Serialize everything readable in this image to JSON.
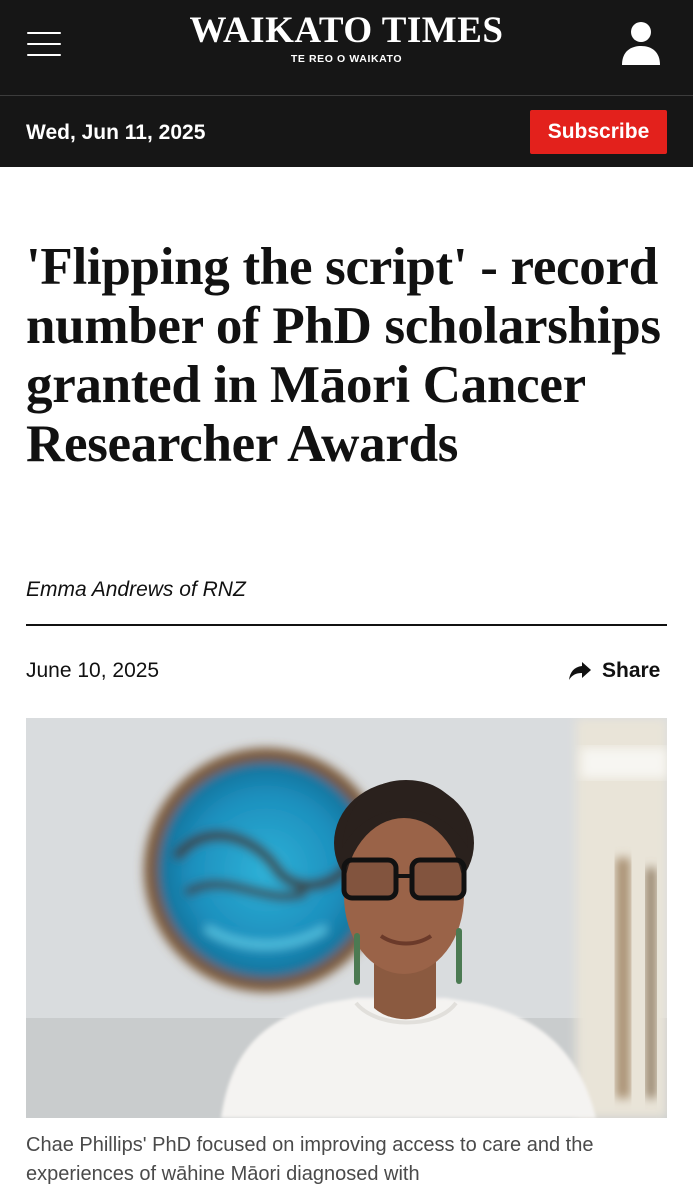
{
  "masthead": {
    "title": "WAIKATO TIMES",
    "subtitle": "TE REO O WAIKATO"
  },
  "icons": {
    "menu": "hamburger-menu-icon",
    "account": "user-account-icon",
    "share": "share-arrow-icon"
  },
  "datebar": {
    "date": "Wed, Jun 11, 2025",
    "subscribe_label": "Subscribe"
  },
  "article": {
    "headline": "'Flipping the script' - record number of PhD scholarships granted in Māori Cancer Researcher Awards",
    "byline": "Emma Andrews of RNZ",
    "published": "June 10, 2025",
    "share_label": "Share",
    "caption": "Chae Phillips' PhD focused on improving access to care and the experiences of wāhine Māori diagnosed with"
  },
  "colors": {
    "header_bg": "#161616",
    "subscribe_bg": "#e3211c",
    "text": "#111111",
    "caption_text": "#4a4a4a"
  }
}
